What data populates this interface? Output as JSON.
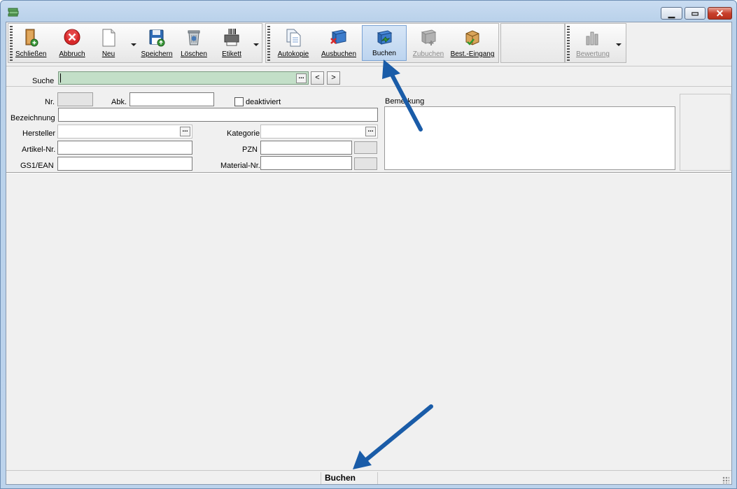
{
  "toolbar1": {
    "items": [
      {
        "label": "Schließen",
        "icon": "door-exit-icon"
      },
      {
        "label": "Abbruch",
        "icon": "cancel-icon"
      },
      {
        "label": "Neu",
        "icon": "new-document-icon"
      },
      {
        "label": "Speichern",
        "icon": "save-icon"
      },
      {
        "label": "Löschen",
        "icon": "trash-icon"
      },
      {
        "label": "Etikett",
        "icon": "barcode-printer-icon"
      }
    ]
  },
  "toolbar2": {
    "items": [
      {
        "label": "Autokopie",
        "icon": "copy-icon"
      },
      {
        "label": "Ausbuchen",
        "icon": "book-out-icon"
      },
      {
        "label": "Buchen",
        "icon": "book-in-icon",
        "state": "pressed"
      },
      {
        "label": "Zubuchen",
        "icon": "book-add-icon",
        "state": "disabled"
      },
      {
        "label": "Best.-Eingang",
        "icon": "package-receive-icon"
      }
    ]
  },
  "toolbar3": {
    "items": [
      {
        "label": "Bewertung",
        "icon": "rating-chart-icon",
        "state": "disabled"
      }
    ]
  },
  "search": {
    "label": "Suche",
    "value": "",
    "prev": "<",
    "next": ">"
  },
  "form": {
    "nr_label": "Nr.",
    "abk_label": "Abk.",
    "deaktiviert_label": "deaktiviert",
    "bezeichnung_label": "Bezeichnung",
    "hersteller_label": "Hersteller",
    "kategorie_label": "Kategorie",
    "artikelnr_label": "Artikel-Nr.",
    "pzn_label": "PZN",
    "gs1_label": "GS1/EAN",
    "materialnr_label": "Material-Nr.",
    "bemerkung_label": "Bemerkung",
    "ellipsis": "..."
  },
  "status": {
    "text": "Buchen"
  },
  "colors": {
    "accent_arrow": "#1a5ca8",
    "search_bg": "#c3dfc8"
  }
}
